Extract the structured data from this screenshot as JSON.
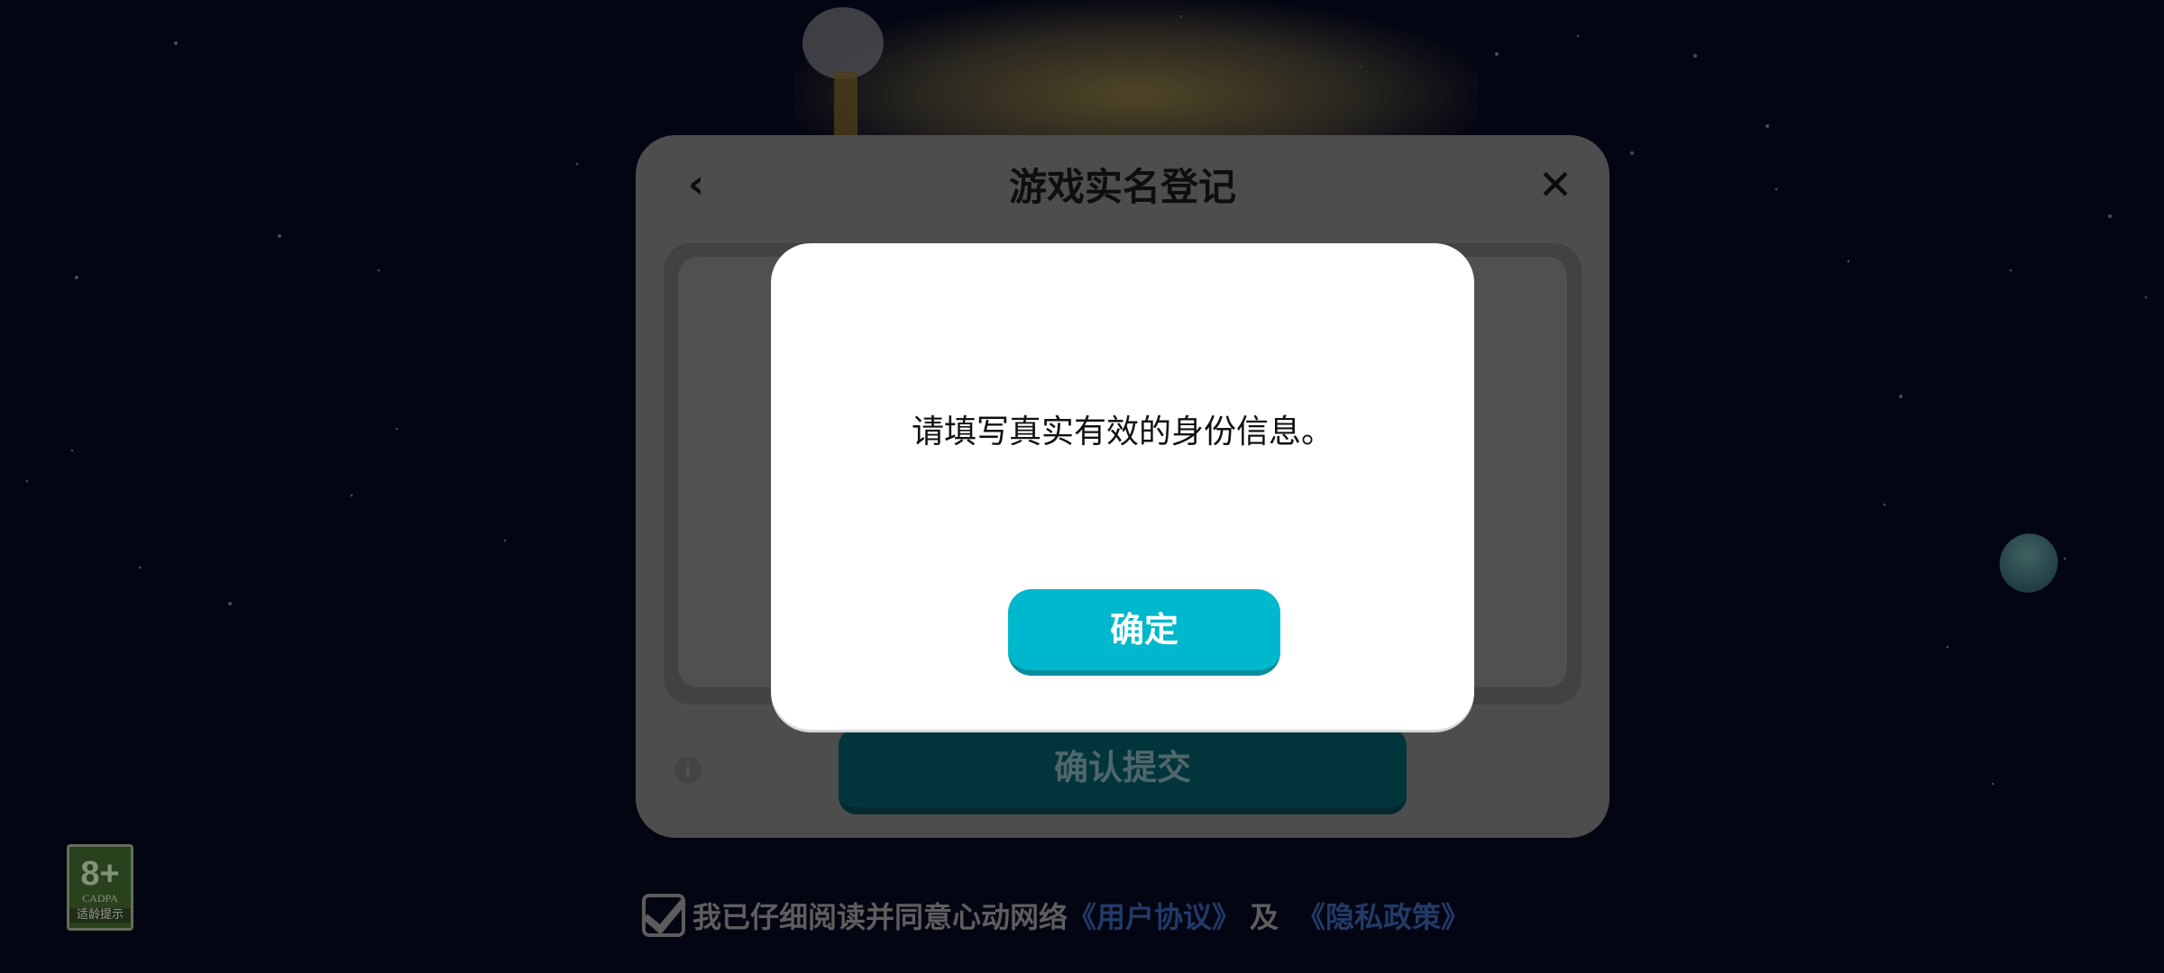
{
  "registration": {
    "back_icon": "chevron-left-icon",
    "back_glyph": "‹",
    "title": "游戏实名登记",
    "close_icon": "close-icon",
    "close_glyph": "✕",
    "info_icon": "info-icon",
    "info_glyph": "i",
    "submit_label": "确认提交"
  },
  "agreement": {
    "checked": true,
    "text": "我已仔细阅读并同意心动网络",
    "user_agreement_link": "《用户协议》",
    "and": "及",
    "privacy_policy_link": "《隐私政策》"
  },
  "age_rating": {
    "age": "8+",
    "org": "CADPA",
    "tip": "适龄提示"
  },
  "alert": {
    "message": "请填写真实有效的身份信息。",
    "ok_label": "确定"
  },
  "colors": {
    "accent": "#00b8cd",
    "background": "#05081a"
  }
}
